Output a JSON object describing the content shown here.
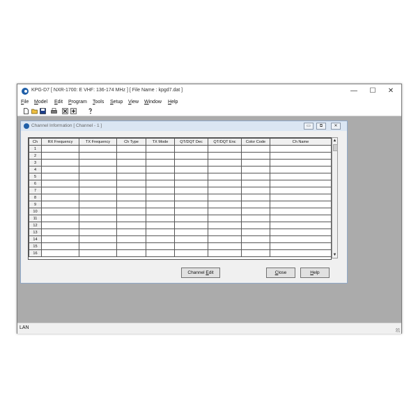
{
  "window": {
    "title": "KPG-D7  [ NXR-1700: E  VHF: 136-174 MHz ] [ File Name : kpgd7.dat ]",
    "controls": {
      "minimize": "—",
      "maximize": "☐",
      "close": "✕"
    }
  },
  "menu": {
    "items": [
      {
        "accel": "F",
        "rest": "ile"
      },
      {
        "accel": "M",
        "rest": "odel"
      },
      {
        "accel": "E",
        "rest": "dit"
      },
      {
        "accel": "P",
        "rest": "rogram"
      },
      {
        "accel": "T",
        "rest": "ools"
      },
      {
        "accel": "S",
        "rest": "etup"
      },
      {
        "accel": "V",
        "rest": "iew"
      },
      {
        "accel": "W",
        "rest": "indow"
      },
      {
        "accel": "H",
        "rest": "elp"
      }
    ]
  },
  "toolbar": {
    "icons": [
      "new-file-icon",
      "open-folder-icon",
      "save-icon",
      "print-icon",
      "read-radio-icon",
      "write-radio-icon",
      "help-icon"
    ]
  },
  "channel_window": {
    "title": "Channel Information [ Channel - 1 ]",
    "controls": {
      "minimize": "▭",
      "restore": "⧉",
      "close": "✕"
    },
    "columns": [
      "Ch",
      "RX Frequency",
      "TX Frequency",
      "Ch Type",
      "TX Mode",
      "QT/DQT Dec",
      "QT/DQT Enc",
      "Color Code",
      "Ch Name"
    ],
    "rows": [
      "1",
      "2",
      "3",
      "4",
      "5",
      "6",
      "7",
      "8",
      "9",
      "10",
      "11",
      "12",
      "13",
      "14",
      "15",
      "16"
    ],
    "buttons": {
      "channel_edit": {
        "pre": "Channel ",
        "accel": "E",
        "post": "dit"
      },
      "close": {
        "pre": "",
        "accel": "C",
        "post": "lose"
      },
      "help": {
        "pre": "",
        "accel": "H",
        "post": "elp"
      }
    }
  },
  "statusbar": {
    "text": "LAN"
  },
  "colors": {
    "workspace": "#ababab",
    "child_title_bar": "#dbe6f3",
    "icon_blue": "#1f5fa8"
  }
}
